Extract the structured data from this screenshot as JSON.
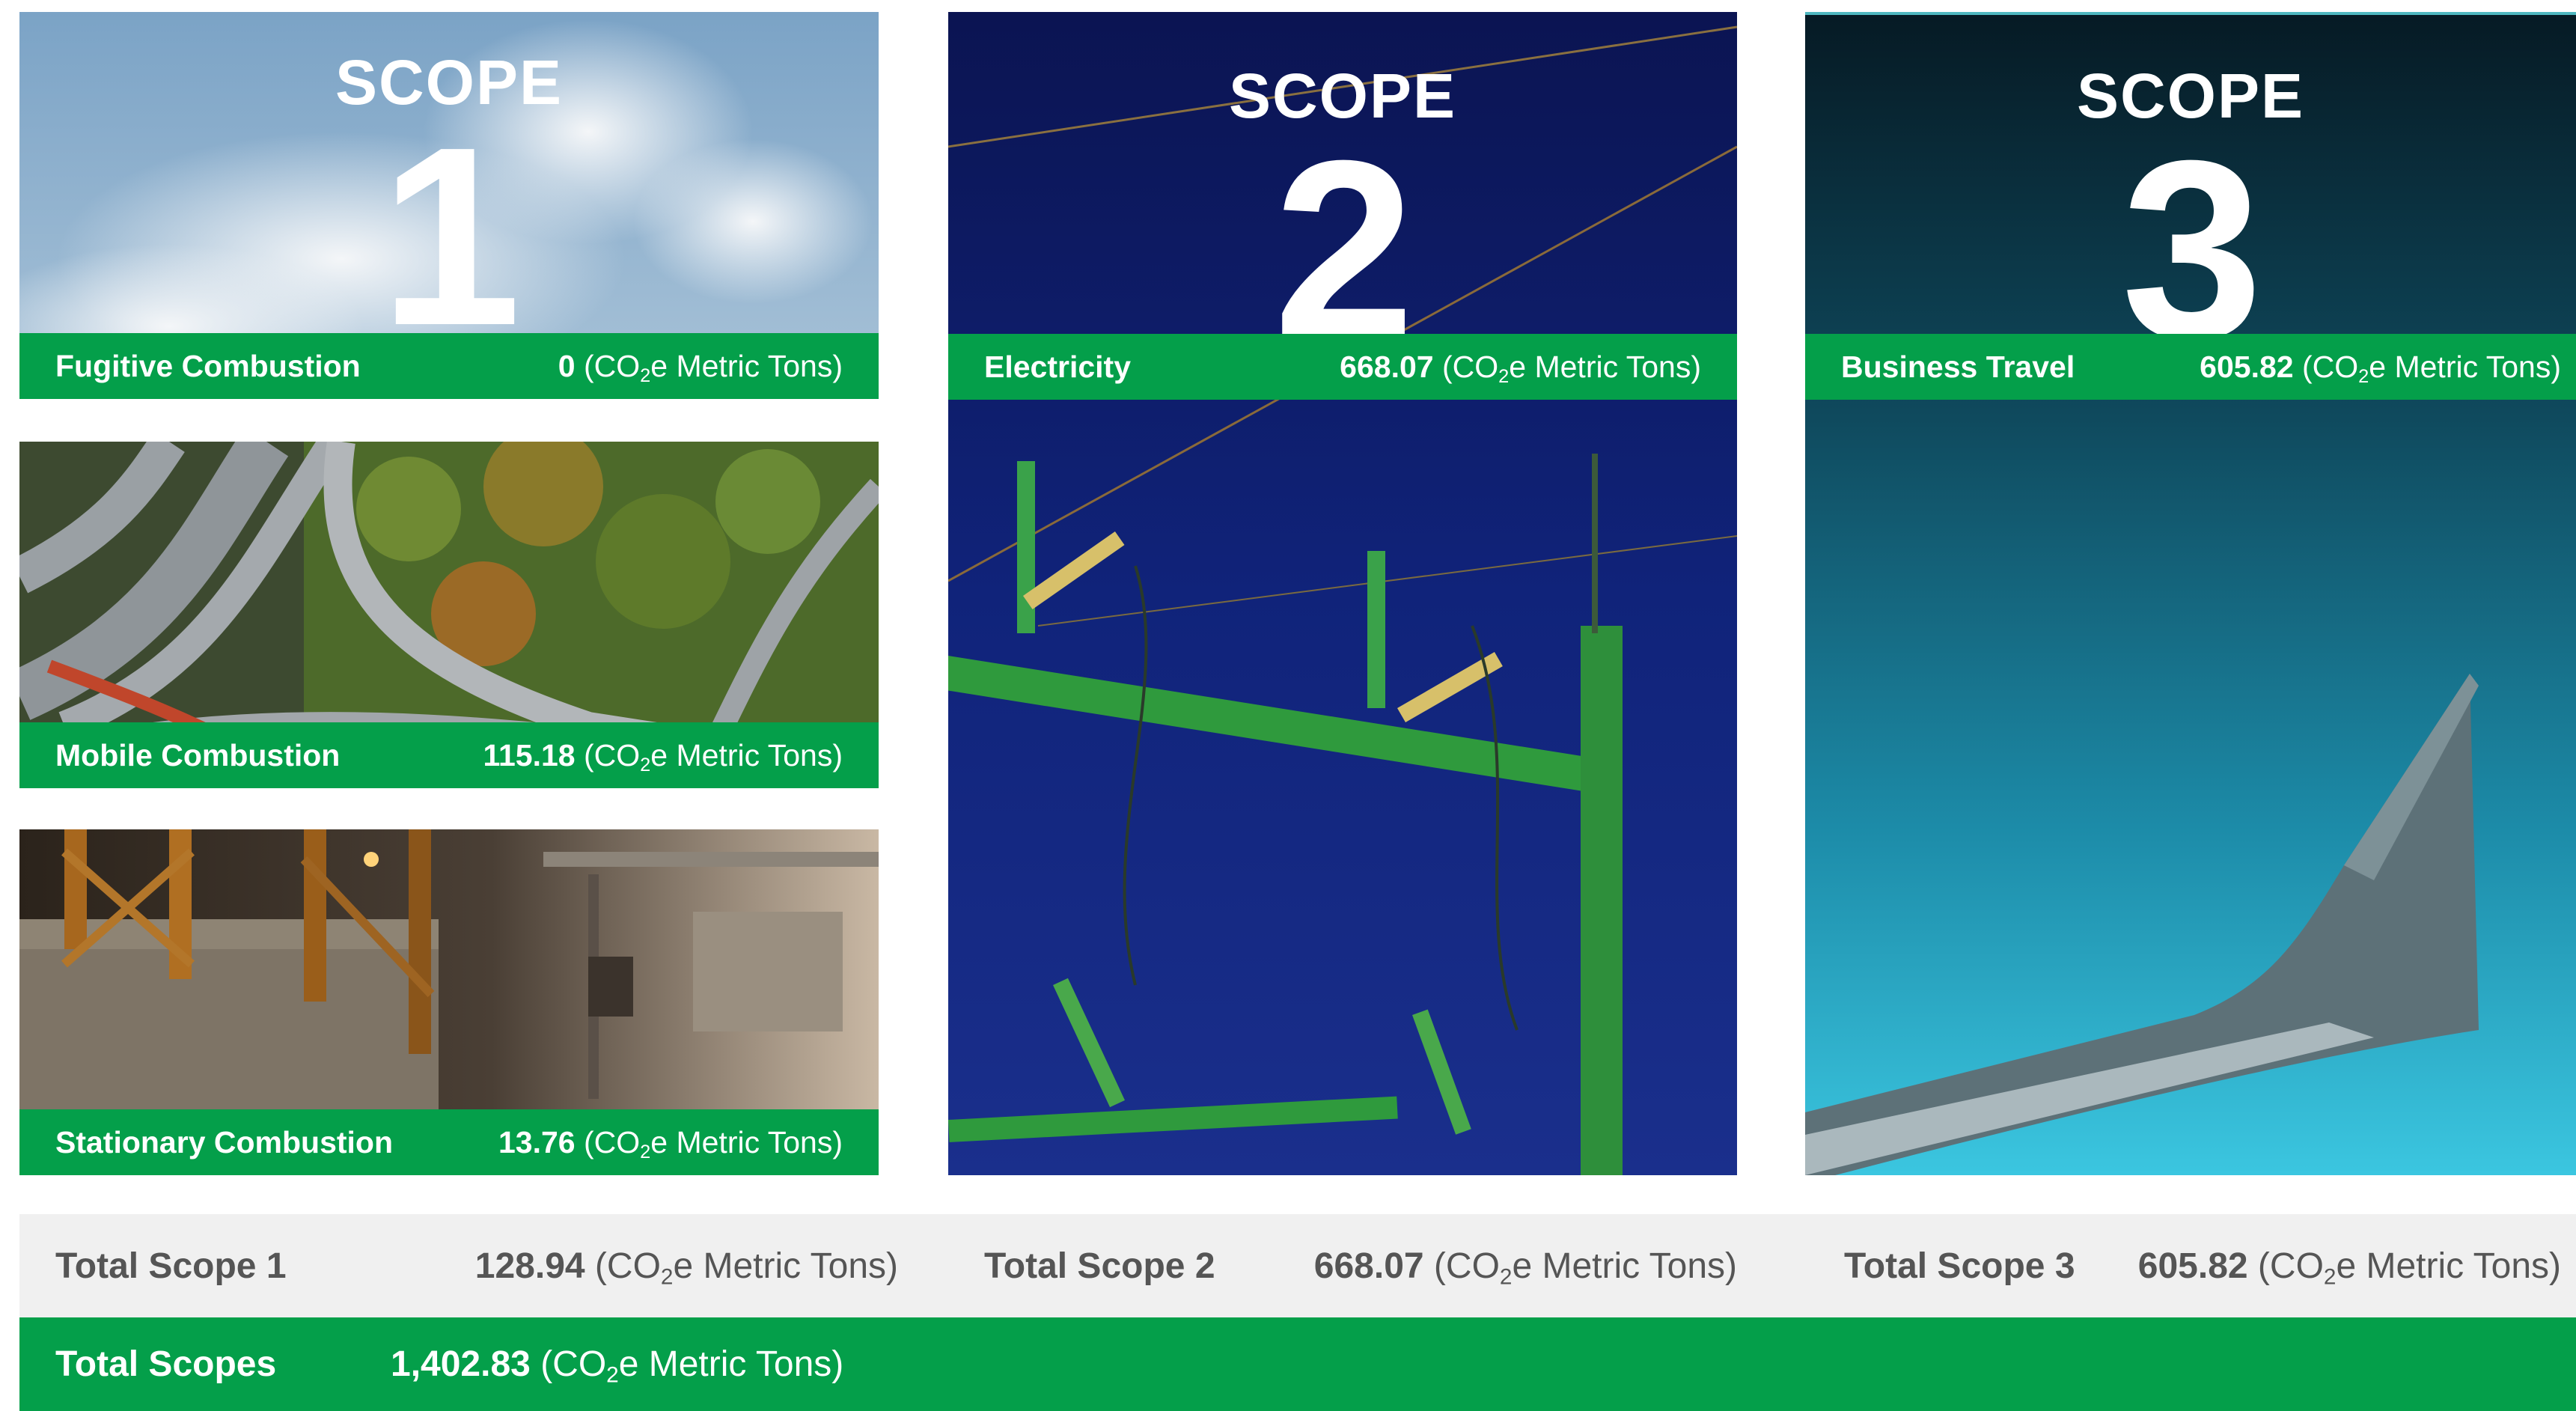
{
  "scope_word": "SCOPE",
  "unit": {
    "pre": "(CO",
    "sub": "2",
    "post": "e Metric Tons)"
  },
  "scope1": {
    "number": "1",
    "items": [
      {
        "label": "Fugitive Combustion",
        "value": "0"
      },
      {
        "label": "Mobile Combustion",
        "value": "115.18"
      },
      {
        "label": "Stationary Combustion",
        "value": "13.76"
      }
    ]
  },
  "scope2": {
    "number": "2",
    "item": {
      "label": "Electricity",
      "value": "668.07"
    }
  },
  "scope3": {
    "number": "3",
    "item": {
      "label": "Business Travel",
      "value": "605.82"
    }
  },
  "totals": [
    {
      "label": "Total Scope 1",
      "value": "128.94"
    },
    {
      "label": "Total Scope 2",
      "value": "668.07"
    },
    {
      "label": "Total Scope 3",
      "value": "605.82"
    }
  ],
  "grand_total": {
    "label": "Total Scopes",
    "value": "1,402.83"
  },
  "colors": {
    "accent_green": "#049f4a",
    "totals_bg": "#f0f0f0",
    "totals_text": "#555555"
  }
}
